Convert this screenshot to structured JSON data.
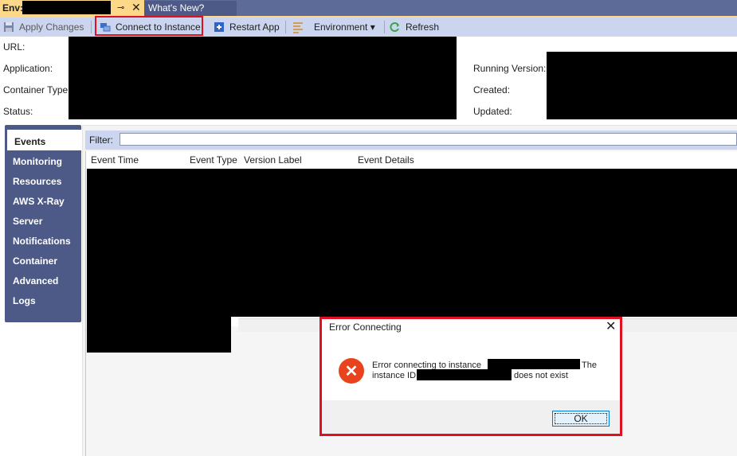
{
  "tabs": {
    "env_label": "Env:",
    "pin_glyph": "⊸",
    "close_glyph": "✕",
    "whats_new": "What's New?"
  },
  "toolbar": {
    "apply_changes": "Apply Changes",
    "connect_to_instance": "Connect to Instance",
    "restart_app": "Restart App",
    "environment": "Environment ▾",
    "refresh": "Refresh"
  },
  "info": {
    "url_label": "URL:",
    "application_label": "Application:",
    "container_type_label": "Container Type:",
    "status_label": "Status:",
    "running_version_label": "Running Version:",
    "created_label": "Created:",
    "updated_label": "Updated:"
  },
  "nav": {
    "items": [
      "Events",
      "Monitoring",
      "Resources",
      "AWS X-Ray",
      "Server",
      "Notifications",
      "Container",
      "Advanced",
      "Logs"
    ],
    "active": "Events"
  },
  "events": {
    "filter_label": "Filter:",
    "filter_value": "",
    "columns": [
      "Event Time",
      "Event Type",
      "Version Label",
      "Event Details"
    ]
  },
  "dialog": {
    "title": "Error Connecting",
    "close_glyph": "✕",
    "icon_glyph": "✕",
    "message_part1": "Error connecting to instance",
    "message_part2": "The",
    "message_part3": "instance ID",
    "message_part4": "does not exist",
    "ok_label": "OK"
  },
  "colors": {
    "tab_active": "#fdd888",
    "tab_strip": "#5d6b99",
    "toolbar": "#ccd5f0",
    "nav": "#4d5a87",
    "highlight": "#e01020",
    "error_icon": "#e8431c"
  }
}
